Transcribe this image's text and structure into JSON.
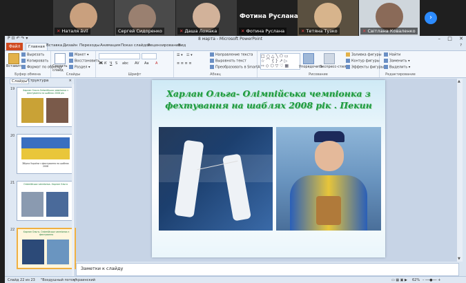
{
  "video": {
    "participants": [
      {
        "name": "Наталя ávil",
        "muted": true
      },
      {
        "name": "Сергей Сидоренко",
        "muted": false
      },
      {
        "name": "Даша Ломака",
        "muted": true
      },
      {
        "name": "Фотина Руслана",
        "muted": true
      },
      {
        "name": "Тетяна Тузко",
        "muted": true
      },
      {
        "name": "Світлана Коваленко",
        "muted": true
      }
    ],
    "active_speaker": "Фотина Руслана",
    "next_icon": "chevron-right-icon"
  },
  "window": {
    "title": "8 марта - Microsoft PowerPoint",
    "qat": "P ⊡ ↶ ↷ ▾"
  },
  "ribbon": {
    "file_tab": "Файл",
    "tabs": [
      "Главная",
      "Вставка",
      "Дизайн",
      "Переходы",
      "Анимация",
      "Показ слайдов",
      "Рецензирование",
      "Вид"
    ],
    "groups": {
      "clipboard": {
        "label": "Буфер обмена",
        "paste": "Вставить",
        "cut": "Вырезать",
        "copy": "Копировать",
        "format_painter": "Формат по образцу"
      },
      "slides": {
        "label": "Слайды",
        "new_slide": "Создать слайд",
        "layout": "Макет",
        "reset": "Восстановить",
        "section": "Раздел"
      },
      "font": {
        "label": "Шрифт"
      },
      "paragraph": {
        "label": "Абзац",
        "text_direction": "Направление текста",
        "align_text": "Выровнять текст",
        "smartart": "Преобразовать в SmartArt"
      },
      "drawing": {
        "label": "Рисование",
        "arrange": "Упорядочить",
        "quick_styles": "Экспресс-стили",
        "fill": "Заливка фигуры",
        "outline": "Контур фигуры",
        "effects": "Эффекты фигуры"
      },
      "editing": {
        "label": "Редактирование",
        "find": "Найти",
        "replace": "Заменить",
        "select": "Выделить"
      }
    }
  },
  "pane": {
    "tab_slides": "Слайды",
    "tab_outline": "Структура",
    "close": "×",
    "thumbs": [
      {
        "num": "19",
        "title": "Харлан Ольга-Олімпійська чемпіонка з фехтування на шаблях 2008 рік",
        "selected": false
      },
      {
        "num": "20",
        "title": "Збірна України з фехтування на шаблях 2008",
        "selected": false
      },
      {
        "num": "21",
        "title": "Олімпійська чемпіонка. Харлан Ольга",
        "selected": false
      },
      {
        "num": "22",
        "title": "Харлан Ольга- Олімпійська чемпіонка з фехтування",
        "selected": true
      }
    ]
  },
  "slide": {
    "title": "Харлан Ольга- Олімпійська чемпіонка з фехтування на шаблях 2008 рік . Пекин"
  },
  "notes": {
    "text": "Заметки к слайду"
  },
  "status": {
    "slide": "Слайд 22 из 23",
    "theme": "\"Воздушный поток\"",
    "lang": "украинский",
    "zoom": "62%"
  }
}
